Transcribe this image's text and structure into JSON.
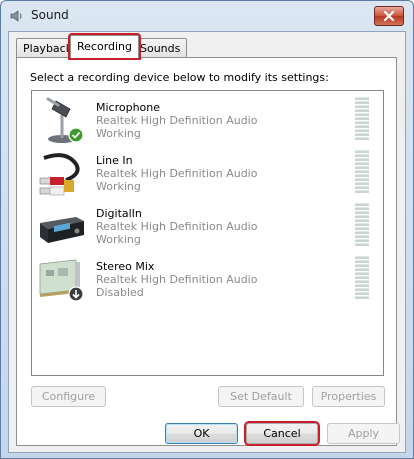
{
  "window": {
    "title": "Sound"
  },
  "tabs": [
    {
      "label": "Playback",
      "active": false
    },
    {
      "label": "Recording",
      "active": true
    },
    {
      "label": "Sounds",
      "active": false
    }
  ],
  "instruction": "Select a recording device below to modify its settings:",
  "devices": [
    {
      "name": "Microphone",
      "description": "Realtek High Definition Audio",
      "status": "Working",
      "icon": "microphone-icon",
      "default": true
    },
    {
      "name": "Line In",
      "description": "Realtek High Definition Audio",
      "status": "Working",
      "icon": "line-in-cable-icon",
      "default": false
    },
    {
      "name": "DigitalIn",
      "description": "Realtek High Definition Audio",
      "status": "Working",
      "icon": "digital-in-device-icon",
      "default": false
    },
    {
      "name": "Stereo Mix",
      "description": "Realtek High Definition Audio",
      "status": "Disabled",
      "icon": "sound-card-icon",
      "default": false
    }
  ],
  "buttons": {
    "configure": "Configure",
    "set_default": "Set Default",
    "properties": "Properties",
    "ok": "OK",
    "cancel": "Cancel",
    "apply": "Apply"
  },
  "colors": {
    "highlight": "#c8202a",
    "title_bar": "#c5d6ea"
  }
}
